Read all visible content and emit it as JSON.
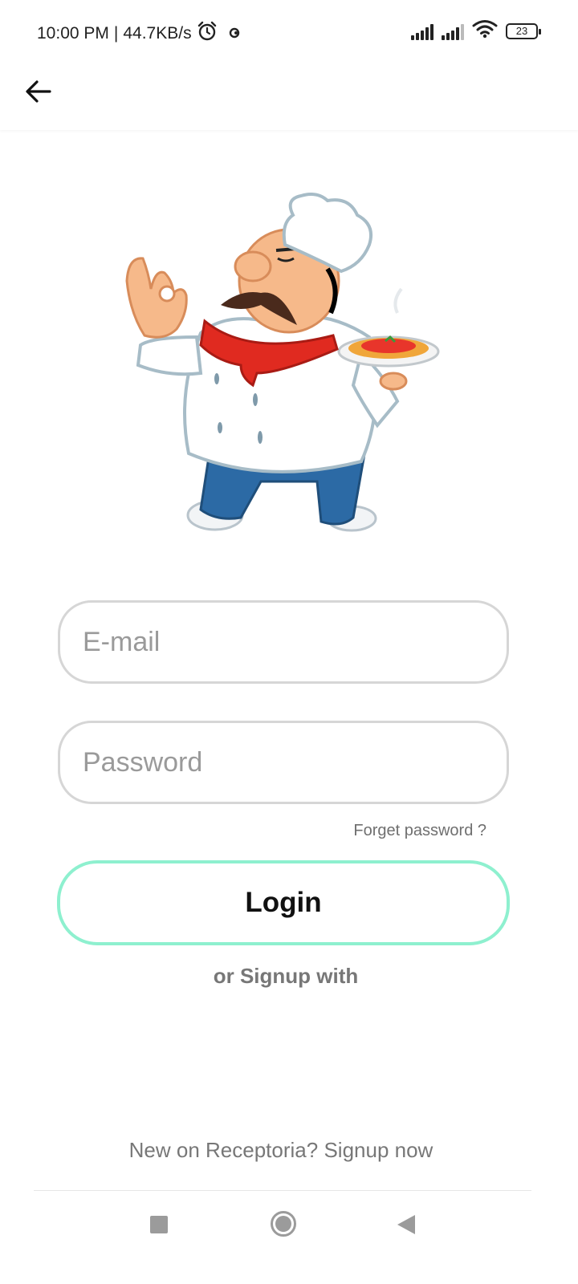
{
  "status_bar": {
    "time": "10:00 PM",
    "separator": "|",
    "network_speed": "44.7KB/s",
    "battery_level": "23",
    "icons": [
      "alarm-icon",
      "app-notification-icon",
      "signal-icon",
      "signal-icon",
      "wifi-icon",
      "battery-icon"
    ]
  },
  "app_bar": {
    "back_icon": "arrow-left-icon"
  },
  "form": {
    "email_placeholder": "E-mail",
    "email_value": "",
    "password_placeholder": "Password",
    "password_value": "",
    "forgot_password": "Forget password ?",
    "login_label": "Login",
    "signup_with": "or Signup with"
  },
  "footer": {
    "prompt": "New on Receptoria?",
    "signup_now": "Signup now"
  },
  "colors": {
    "login_border": "#8ef0cf",
    "input_border": "#d6d6d6",
    "muted_text": "#777777"
  },
  "nav_bar": {
    "icons": [
      "recent-apps-icon",
      "home-icon",
      "back-triangle-icon"
    ]
  }
}
